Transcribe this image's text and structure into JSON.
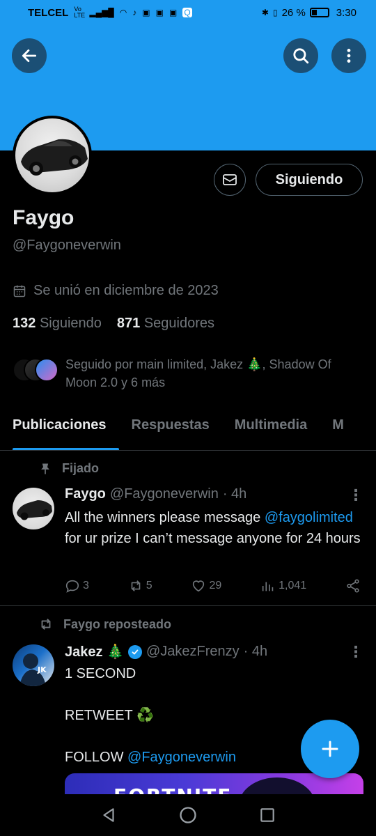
{
  "status_bar": {
    "carrier": "TELCEL",
    "volte": "Vo LTE",
    "battery": "26 %",
    "time": "3:30"
  },
  "profile": {
    "name": "Faygo",
    "handle": "@Faygoneverwin",
    "joined": "Se unió en diciembre de 2023",
    "following_count": "132",
    "following_label": "Siguiendo",
    "followers_count": "871",
    "followers_label": "Seguidores",
    "followed_by": "Seguido por main limited, Jakez 🎄, Shadow Of Moon 2.0 y 6 más",
    "follow_button": "Siguiendo"
  },
  "tabs": [
    {
      "label": "Publicaciones",
      "active": true
    },
    {
      "label": "Respuestas"
    },
    {
      "label": "Multimedia"
    },
    {
      "label": "M"
    }
  ],
  "posts": [
    {
      "context": "Fijado",
      "author": "Faygo",
      "handle": "@Faygoneverwin",
      "time": "· 4h",
      "text_before": "All the winners please message ",
      "mention": "@faygolimited",
      "text_after": " for ur prize I can’t message anyone for 24 hours",
      "replies": "3",
      "reposts": "5",
      "likes": "29",
      "views": "1,041"
    },
    {
      "context": "Faygo reposteado",
      "author": "Jakez 🎄",
      "handle": "@JakezFrenzy",
      "time": "· 4h",
      "line1": "1 SECOND",
      "line2": "RETWEET ♻️",
      "line3_prefix": "FOLLOW ",
      "line3_mention": "@Faygoneverwin",
      "media_text": "FORTNITE"
    }
  ],
  "colors": {
    "accent": "#1d9bf0",
    "background": "#000000",
    "muted": "#71767b"
  }
}
